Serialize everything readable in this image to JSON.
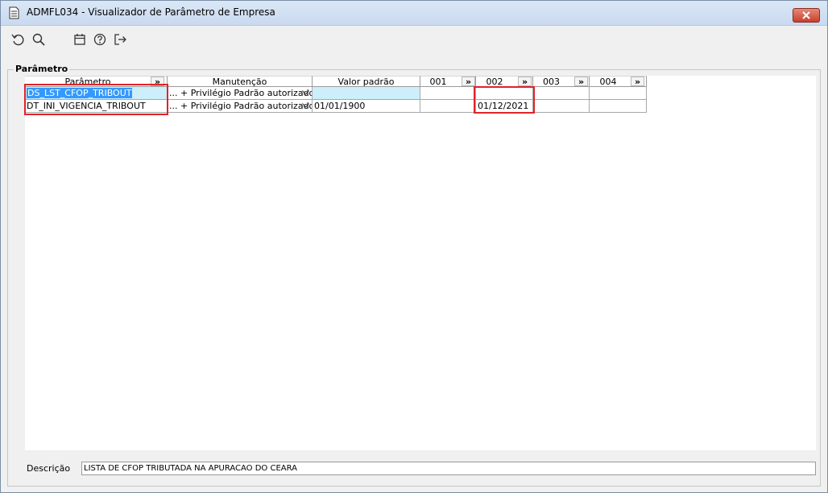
{
  "window": {
    "title": "ADMFL034 - Visualizador de Parâmetro de Empresa",
    "title_icon": "document-icon",
    "close_icon": "close-icon"
  },
  "toolbar": {
    "buttons": [
      {
        "icon": "refresh-icon"
      },
      {
        "icon": "search-icon"
      },
      {
        "icon": "calendar-icon"
      },
      {
        "icon": "help-icon"
      },
      {
        "icon": "exit-icon"
      }
    ]
  },
  "group": {
    "label": "Parâmetro"
  },
  "grid": {
    "headers": {
      "parametro": "Parâmetro",
      "manutencao": "Manutenção",
      "valor_padrao": "Valor padrão",
      "c001": "001",
      "c002": "002",
      "c003": "003",
      "c004": "004",
      "expand": "»"
    },
    "rows": [
      {
        "parametro": "DS_LST_CFOP_TRIBOUT",
        "manutencao": "... + Privilégio Padrão autorizado",
        "valor_padrao": "",
        "c001": "",
        "c002": "",
        "c003": "",
        "c004": ""
      },
      {
        "parametro": "DT_INI_VIGENCIA_TRIBOUT",
        "manutencao": "... + Privilégio Padrão autorizado",
        "valor_padrao": "01/01/1900",
        "c001": "",
        "c002": "01/12/2021",
        "c003": "",
        "c004": ""
      }
    ]
  },
  "description": {
    "label": "Descrição",
    "value": "LISTA DE CFOP TRIBUTADA NA APURACAO DO CEARA"
  },
  "colors": {
    "highlight": "#e0242a",
    "selection": "#3399ff",
    "cyan_cell": "#cdeffc",
    "titlebar": "#c9d9ef"
  }
}
